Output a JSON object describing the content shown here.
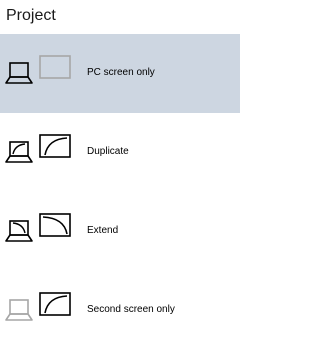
{
  "panel": {
    "title": "Project"
  },
  "colors": {
    "selected_background": "#cdd6e1",
    "icon_active": "#000000",
    "icon_inactive": "#a6a6a6"
  },
  "options": [
    {
      "label": "PC screen only",
      "icon": "pc-screen-only-icon",
      "selected": true
    },
    {
      "label": "Duplicate",
      "icon": "duplicate-icon",
      "selected": false
    },
    {
      "label": "Extend",
      "icon": "extend-icon",
      "selected": false
    },
    {
      "label": "Second screen only",
      "icon": "second-screen-only-icon",
      "selected": false
    }
  ]
}
